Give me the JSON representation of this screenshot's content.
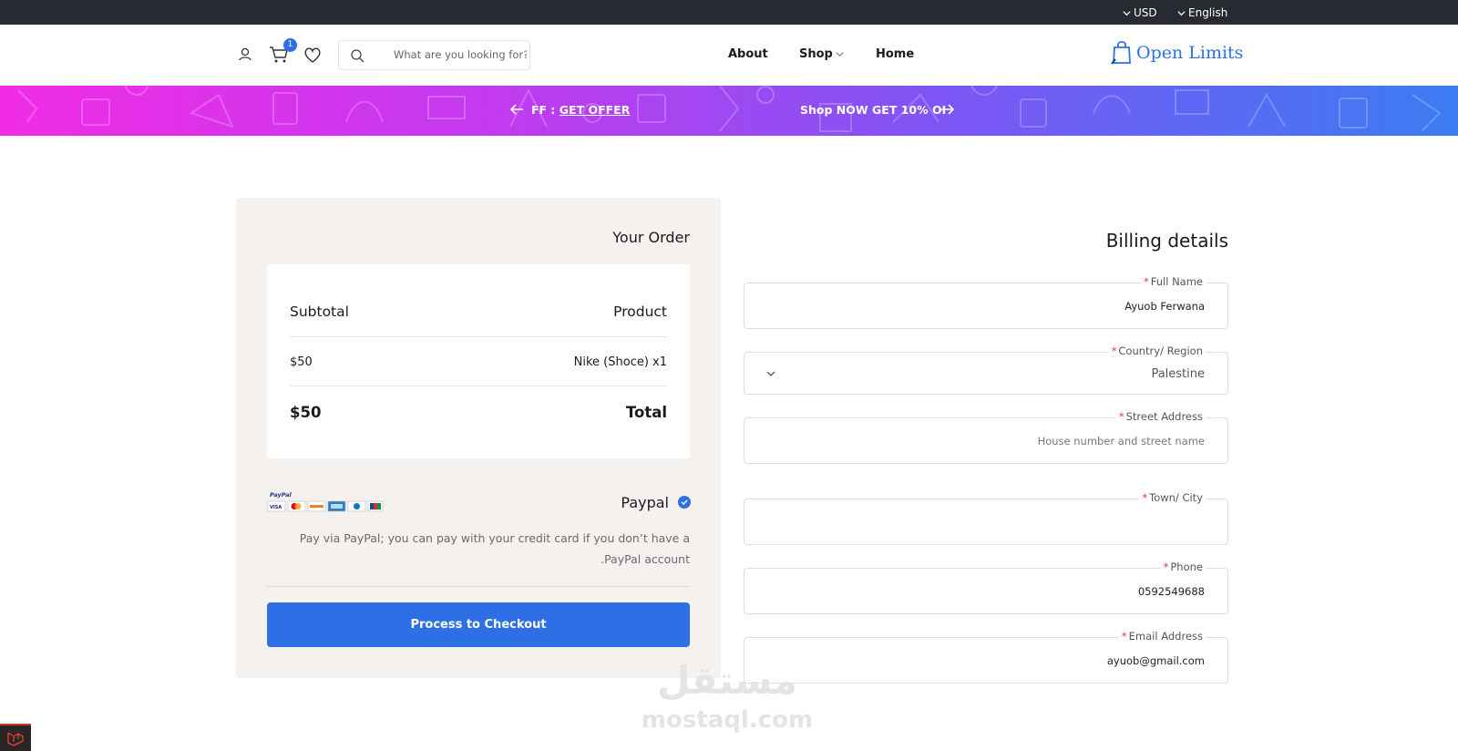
{
  "topbar": {
    "currency": "USD",
    "language": "English"
  },
  "header": {
    "cart_count": "1",
    "search_placeholder": "What are you looking for?",
    "nav": [
      "About",
      "Shop",
      "Home"
    ],
    "brand": "Open Limits"
  },
  "banner": {
    "left_prefix": "FF :",
    "left_link": "GET OFFER",
    "right_text": "Shop NOW GET 10% OI"
  },
  "order": {
    "title": "Your Order",
    "col_left": "Subtotal",
    "col_right": "Product",
    "item_price": "$50",
    "item_name": "Nike (Shoce) x1",
    "total_value": "$50",
    "total_label": "Total",
    "payment_method": "Paypal",
    "payment_logos_label": "PayPal",
    "payment_desc_line1": "Pay via PayPal; you can pay with your credit card if you don’t have a",
    "payment_desc_line2": ".PayPal account",
    "checkout_label": "Process to Checkout"
  },
  "billing": {
    "title": "Billing details",
    "fields": [
      {
        "label": "Full Name",
        "value": "Ayuob Ferwana",
        "placeholder": ""
      },
      {
        "label": "Country/ Region",
        "value": "Palestine",
        "placeholder": ""
      },
      {
        "label": "Street Address",
        "value": "",
        "placeholder": "House number and street name"
      },
      {
        "label": "Town/ City",
        "value": "",
        "placeholder": ""
      },
      {
        "label": "Phone",
        "value": "0592549688",
        "placeholder": ""
      },
      {
        "label": "Email Address",
        "value": "ayuob@gmail.com",
        "placeholder": ""
      }
    ]
  },
  "watermark": {
    "arabic": "مستقل",
    "latin": "mostaql.com"
  },
  "colors": {
    "accent": "#2f6fe6",
    "topbar": "#272a31",
    "panel": "#f5f1ee",
    "required": "#e53935"
  },
  "icons": [
    "chevron-down-icon",
    "user-icon",
    "cart-icon",
    "heart-icon",
    "search-icon",
    "shopping-bag-logo-icon",
    "arrow-left-icon",
    "arrow-right-icon",
    "check-icon"
  ]
}
